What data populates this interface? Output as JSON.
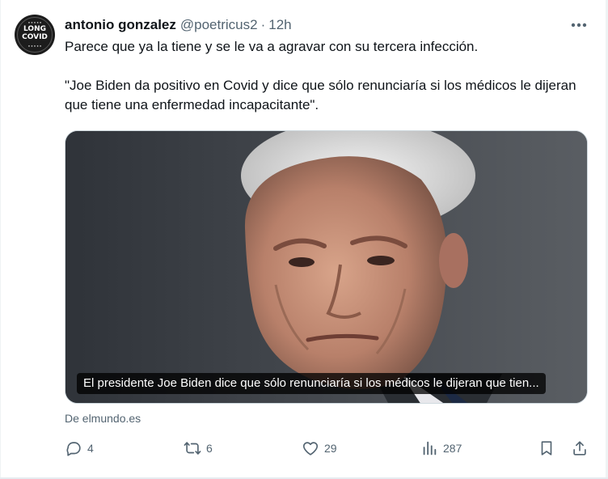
{
  "author": {
    "display_name": "antonio gonzalez",
    "handle": "@poetricus2",
    "separator": "·",
    "time": "12h",
    "avatar_lines": [
      "LONG",
      "COVID"
    ]
  },
  "tweet": {
    "paragraphs": [
      "Parece que ya la tiene y se le va a agravar con su tercera infección.",
      "\"Joe Biden da positivo en Covid y dice que sólo renunciaría si los médicos le dijeran que tiene una enfermedad incapacitante\"."
    ]
  },
  "card": {
    "caption": "El presidente Joe Biden dice que sólo renunciaría si los médicos le dijeran que tien...",
    "source": "De elmundo.es"
  },
  "actions": {
    "replies": "4",
    "reposts": "6",
    "likes": "29",
    "views": "287"
  },
  "colors": {
    "text": "#0f1419",
    "secondary": "#536471",
    "border": "#cfd9de"
  }
}
